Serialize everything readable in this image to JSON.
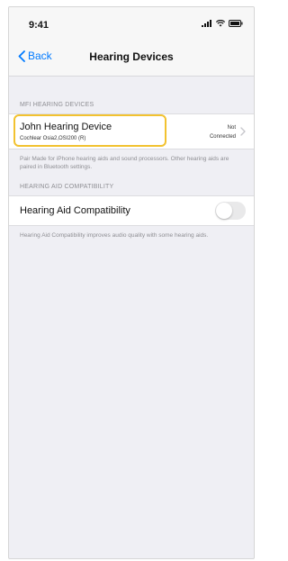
{
  "status_bar": {
    "time": "9:41"
  },
  "nav": {
    "back_label": "Back",
    "title": "Hearing Devices"
  },
  "mfi_section": {
    "header": "MFi HEARING DEVICES",
    "device": {
      "name": "John Hearing Device",
      "model": "Cochlear Osia2,OSI200 (R)",
      "status_line1": "Not",
      "status_line2": "Connected"
    },
    "footer": "Pair Made for iPhone hearing aids and sound processors. Other hearing aids are paired in Bluetooth settings."
  },
  "compat_section": {
    "header": "HEARING AID COMPATIBILITY",
    "label": "Hearing Aid Compatibility",
    "toggle_on": false,
    "footer": "Hearing Aid Compatibility improves audio quality with some hearing aids."
  },
  "colors": {
    "accent": "#007aff",
    "highlight": "#f2c230",
    "background": "#efeff4"
  }
}
